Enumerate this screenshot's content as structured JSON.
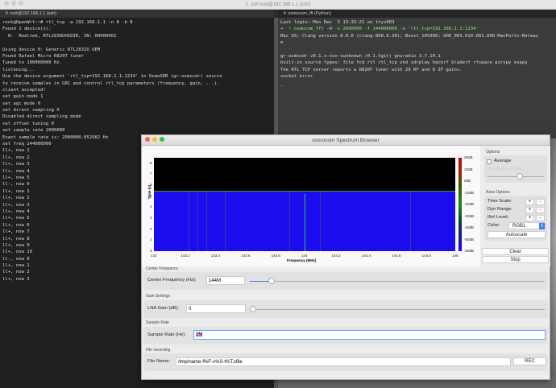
{
  "terminal": {
    "window_title": "1. ssh root@192.168.1.1 (ssh)",
    "tabs": [
      "root@192.168.1.1 (ssh)",
      "osmocom_fft (Python)"
    ],
    "left_lines": [
      "root@OpenWrt:~# rtl_tcp -a 192.168.1.1 -n 8 -b 8",
      "Found 1 device(s):",
      "  0:  Realtek, RTL2838UHIDIR, SN: 00000001",
      "",
      "Using device 0: Generic RTL2832U OEM",
      "Found Rafael Micro R820T tuner",
      "Tuned to 100000000 Hz.",
      "listening...",
      "Use the device argument 'rtl_tcp=192.168.1.1:1234' in OsmoSDR (gr-osmosdr) source",
      "to receive samples in GRC and control rtl_tcp parameters (frequency, gain, ...).",
      "client accepted!",
      "set gain mode 1",
      "set agc mode 0",
      "set direct sampling 0",
      "Disabled direct sampling mode",
      "set offset tuning 0",
      "set sample rate 2000000",
      "Exact sample rate is: 2000000.052982 Hz",
      "set freq 144000000",
      "ll+, now 1",
      "ll+, now 2",
      "ll+, now 3",
      "ll+, now 4",
      "ll+, now 5",
      "ll-, now 0",
      "ll+, now 1",
      "ll+, now 2",
      "ll+, now 3",
      "ll+, now 4",
      "ll+, now 5",
      "ll+, now 6",
      "ll+, now 7",
      "ll+, now 8",
      "ll+, now 9",
      "ll+, now 10",
      "ll-, now 0",
      "ll+, now 1",
      "ll+, now 2",
      "ll+, now 3"
    ],
    "right_lines": [
      "Last login: Mon Dec  5 13:32:21 on ttys003",
      "➜  ~ osmocom_fft -W -s 2000000 -f 144000000 -a 'rtl_tcp=192.168.1.1:1234'",
      "Mac OS; Clang version 8.0.0 (clang-800.0.38); Boost_105900; UHD_003.010.001.000-MacPorts-Releas",
      "e",
      "",
      "gr-osmosdr v0.1.x-xxx-xunknown (0.1.5git) gnuradio 3.7.10.1",
      "built-in source types: file fcd rtl rtl_tcp uhd sdrplay hackrf bladerf rfspace airspy soapy",
      "The RTL TCP server reports a R820T tuner with 29 RF and 0 IF gains.",
      "socket error",
      "_"
    ]
  },
  "spectrum": {
    "title": "osmocom Spectrum Browser",
    "options": {
      "title": "Options",
      "average_label": "Average",
      "average_checked": false,
      "avg_alpha_label": "Avg Alpha: 0.0667",
      "avg_alpha": 0.5
    },
    "axes": {
      "title": "Axes Options",
      "time_scale": "Time Scale:",
      "dyn_range": "Dyn Range:",
      "ref_level": "Ref Level:",
      "plus": "+",
      "minus": "-",
      "color_label": "Color:",
      "color_value": "RGB1",
      "autoscale": "Autoscale"
    },
    "clear": "Clear",
    "stop": "Stop",
    "center_freq": {
      "section": "Center Frequency",
      "label": "Center Frequency (Hz):",
      "value": "144M",
      "slider": 0.07
    },
    "gain": {
      "section": "Gain Settings",
      "label": "LNA Gain (dB):",
      "value": "0",
      "slider": 0
    },
    "sample_rate": {
      "section": "Sample Rate",
      "label": "Sample Rate (Hz):",
      "value": "2M"
    },
    "recording": {
      "section": "File recording",
      "label": "File Name:",
      "value": "/tmp/name-f%F-s%S-t%T.cfile",
      "rec": "REC"
    }
  },
  "chart_data": {
    "type": "heatmap",
    "title": "",
    "xlabel": "Frequency (MHz)",
    "ylabel": "Time (s)",
    "xlim": [
      143,
      145
    ],
    "ylim": [
      0,
      8.5
    ],
    "xticks": [
      "143",
      "143.2",
      "143.4",
      "143.6",
      "143.8",
      "144",
      "144.2",
      "144.4",
      "144.6",
      "144.8",
      "145"
    ],
    "yticks": [
      "0",
      "1",
      "2",
      "3",
      "4",
      "5",
      "6",
      "7",
      "8"
    ],
    "colorbar_ticks": [
      "20dB",
      "10dB",
      "0dB",
      "-10dB",
      "-20dB",
      "-30dB",
      "-40dB",
      "-50dB",
      "-60dB"
    ],
    "filled_time_s": 5.5,
    "background_level_db": -55,
    "signal_lines_mhz": [
      143.23,
      143.29,
      143.35,
      143.47,
      143.9,
      144.0,
      144.1,
      144.7
    ],
    "strong_signal_mhz": 144.0
  }
}
